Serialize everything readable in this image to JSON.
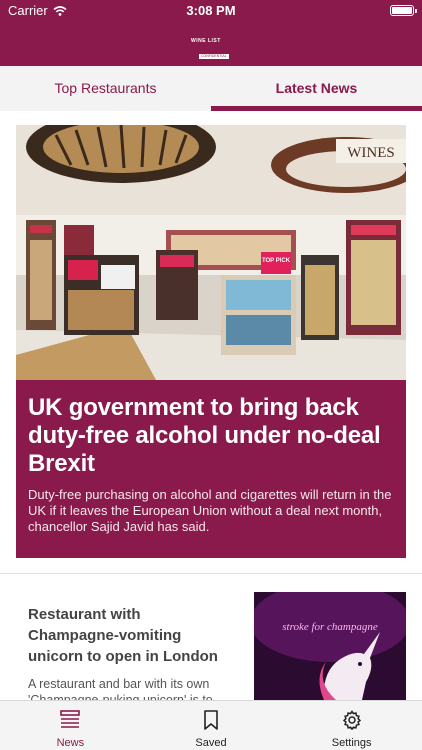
{
  "status_bar": {
    "carrier": "Carrier",
    "time": "3:08 PM"
  },
  "header": {
    "logo_text": "WINE LIST",
    "logo_badge": "CONFIDENTIAL"
  },
  "tabs": [
    {
      "label": "Top Restaurants",
      "active": false
    },
    {
      "label": "Latest News",
      "active": true
    }
  ],
  "feature": {
    "headline": "UK government to bring back duty-free alcohol under no-deal Brexit",
    "summary": "Duty-free purchasing on alcohol and cigarettes will return in the UK if it leaves the European Union without a deal next month, chancellor Sajid Javid has said.",
    "image_sign": "WINES",
    "image_tag": "TOP PICK"
  },
  "list_items": [
    {
      "title": "Restaurant with Champagne-vomiting unicorn to open in London",
      "summary": "A restaurant and bar with its own 'Champagne-puking unicorn' is to",
      "thumb_neon": "stroke for champagne"
    }
  ],
  "bottom_tabs": [
    {
      "label": "News",
      "icon": "news-icon",
      "active": true
    },
    {
      "label": "Saved",
      "icon": "bookmark-icon",
      "active": false
    },
    {
      "label": "Settings",
      "icon": "gear-icon",
      "active": false
    }
  ],
  "colors": {
    "brand": "#8a1a4b",
    "tab_bg": "#f3f3f3"
  }
}
